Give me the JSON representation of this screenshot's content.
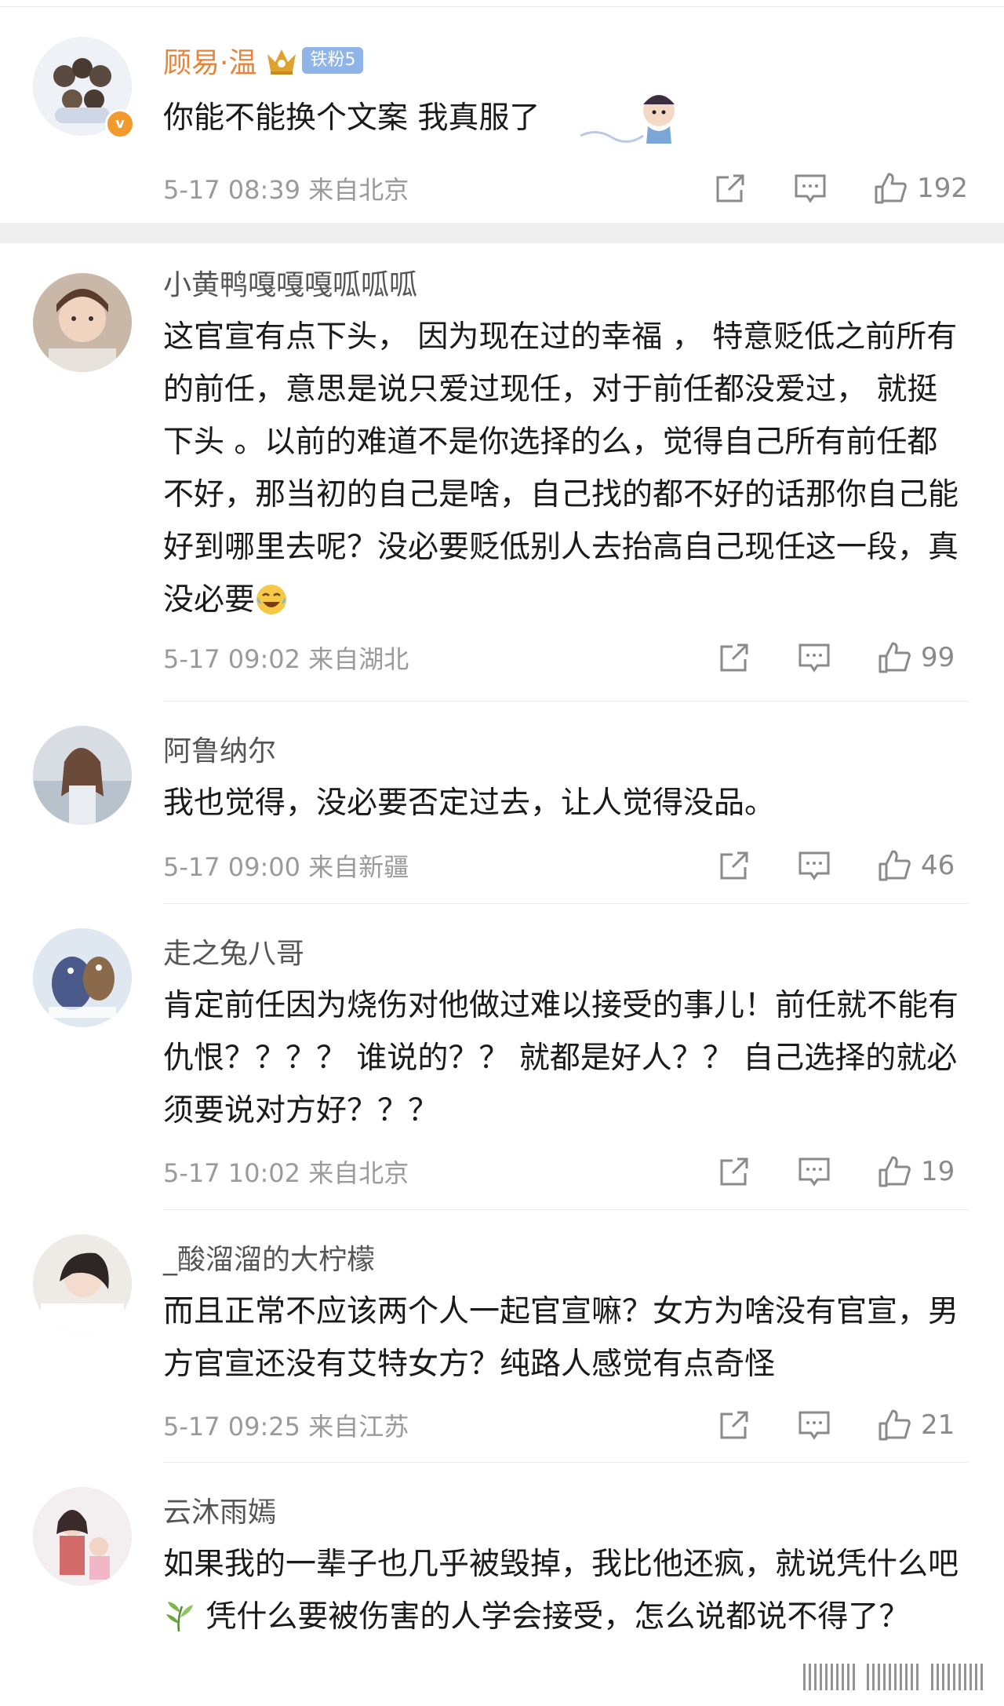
{
  "comments": [
    {
      "name": "顾易·温",
      "fan_badge": "铁粉5",
      "text": "你能不能换个文案 我真服了",
      "time": "5-17 08:39 来自北京",
      "likes": "192"
    },
    {
      "name": "小黄鸭嘎嘎嘎呱呱呱",
      "text": "这官宣有点下头， 因为现在过的幸福 ， 特意贬低之前所有的前任，意思是说只爱过现任，对于前任都没爱过， 就挺下头 。以前的难道不是你选择的么，觉得自己所有前任都不好，那当初的自己是啥，自己找的都不好的话那你自己能好到哪里去呢？没必要贬低别人去抬高自己现任这一段，真没必要",
      "time": "5-17 09:02 来自湖北",
      "likes": "99"
    },
    {
      "name": "阿鲁纳尔",
      "text": "我也觉得，没必要否定过去，让人觉得没品。",
      "time": "5-17 09:00 来自新疆",
      "likes": "46"
    },
    {
      "name": "走之兔八哥",
      "text": "肯定前任因为烧伤对他做过难以接受的事儿！前任就不能有仇恨？？？？ 谁说的？？ 就都是好人？？ 自己选择的就必须要说对方好？？？",
      "time": "5-17 10:02 来自北京",
      "likes": "19"
    },
    {
      "name": "_酸溜溜的大柠檬",
      "text": "而且正常不应该两个人一起官宣嘛？女方为啥没有官宣，男方官宣还没有艾特女方？纯路人感觉有点奇怪",
      "time": "5-17 09:25 来自江苏",
      "likes": "21"
    },
    {
      "name": "云沐雨嫣",
      "text_a": "如果我的一辈子也几乎被毁掉，我比他还疯，就说凭什么吧",
      "text_b": " 凭什么要被伤害的人学会接受，怎么说都说不得了？"
    }
  ],
  "icons": {
    "share": "share-icon",
    "reply": "comment-icon",
    "like": "thumbs-up-icon",
    "emoji_laugh": "laugh-cry-emoji",
    "emoji_leaf": "leaf-emoji"
  },
  "colors": {
    "highlight_name": "#e8833a",
    "name": "#555555",
    "meta": "#9a9a9a",
    "fan_badge": "#8fb4e8",
    "verified": "#f29a2e"
  }
}
